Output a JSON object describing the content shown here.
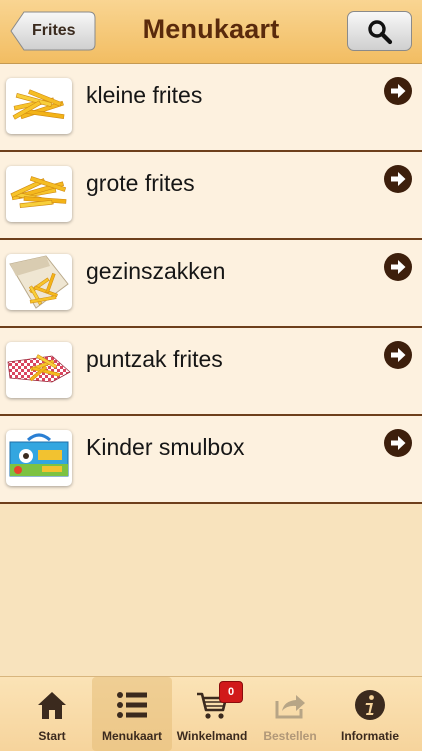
{
  "header": {
    "title": "Menukaart",
    "back_label": "Frites",
    "search_icon": "search-icon"
  },
  "items": [
    {
      "label": "kleine frites",
      "image": "fries-small"
    },
    {
      "label": "grote frites",
      "image": "fries-large"
    },
    {
      "label": "gezinszakken",
      "image": "family-bag"
    },
    {
      "label": "puntzak frites",
      "image": "fries-cone"
    },
    {
      "label": "Kinder smulbox",
      "image": "kids-box"
    }
  ],
  "tabbar": {
    "tabs": [
      {
        "label": "Start",
        "icon": "home-icon"
      },
      {
        "label": "Menukaart",
        "icon": "list-icon",
        "active": true
      },
      {
        "label": "Winkelmand",
        "icon": "cart-icon",
        "badge": "0"
      },
      {
        "label": "Bestellen",
        "icon": "share-icon",
        "disabled": true
      },
      {
        "label": "Informatie",
        "icon": "info-icon"
      }
    ]
  },
  "colors": {
    "header": "#f2bd62",
    "title": "#5a2a0c",
    "row_bg": "#fdf1df",
    "separator": "#6e3f1c",
    "badge": "#d11a1a"
  }
}
